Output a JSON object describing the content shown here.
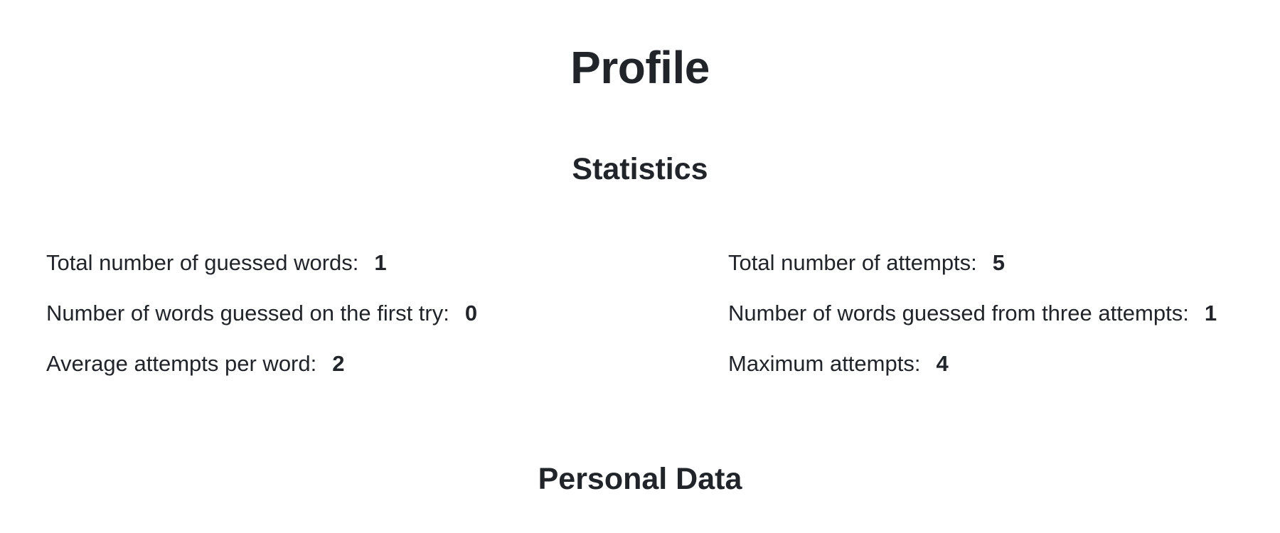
{
  "page": {
    "title": "Profile"
  },
  "statistics": {
    "title": "Statistics",
    "left": [
      {
        "label": "Total number of guessed words:",
        "value": "1"
      },
      {
        "label": "Number of words guessed on the first try:",
        "value": "0"
      },
      {
        "label": "Average attempts per word:",
        "value": "2"
      }
    ],
    "right": [
      {
        "label": "Total number of attempts:",
        "value": "5"
      },
      {
        "label": "Number of words guessed from three attempts:",
        "value": "1"
      },
      {
        "label": "Maximum attempts:",
        "value": "4"
      }
    ]
  },
  "personal_data": {
    "title": "Personal Data"
  }
}
